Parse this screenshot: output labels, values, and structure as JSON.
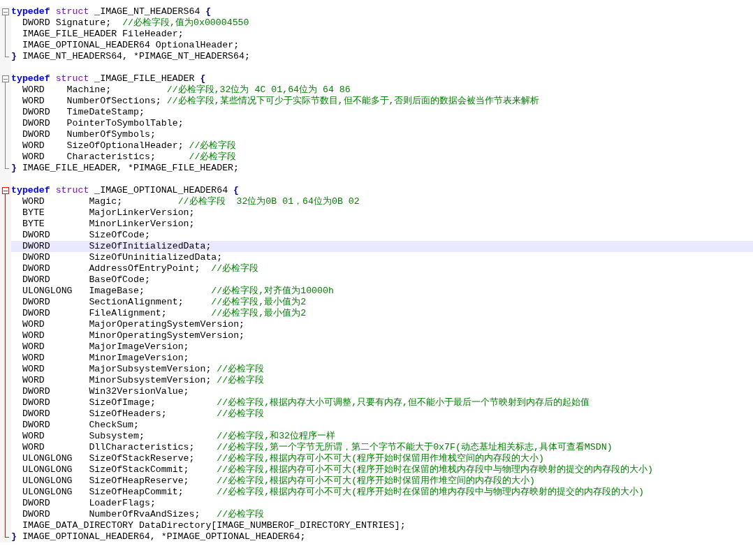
{
  "blocks": [
    {
      "expanded": true,
      "active": false,
      "header": [
        {
          "kind": "keyword",
          "text": "typedef"
        },
        {
          "kind": "storage",
          "text": "struct"
        },
        {
          "kind": "ident",
          "text": "_IMAGE_NT_HEADERS64"
        },
        {
          "kind": "punct",
          "text": "{"
        }
      ],
      "lines": [
        {
          "highlighted": false,
          "code": "DWORD Signature;  ",
          "comment": "//必检字段,值为0x00004550"
        },
        {
          "highlighted": false,
          "code": "IMAGE_FILE_HEADER FileHeader;"
        },
        {
          "highlighted": false,
          "code": "IMAGE_OPTIONAL_HEADER64 OptionalHeader;"
        }
      ],
      "footer": [
        {
          "kind": "punct",
          "text": "}"
        },
        {
          "kind": "ident",
          "text": "IMAGE_NT_HEADERS64, *PIMAGE_NT_HEADERS64;"
        }
      ]
    },
    {
      "expanded": true,
      "active": false,
      "header": [
        {
          "kind": "keyword",
          "text": "typedef"
        },
        {
          "kind": "storage",
          "text": "struct"
        },
        {
          "kind": "ident",
          "text": "_IMAGE_FILE_HEADER"
        },
        {
          "kind": "punct",
          "text": "{"
        }
      ],
      "lines": [
        {
          "highlighted": false,
          "code": "WORD    Machine;          ",
          "comment": "//必检字段,32位为 4C 01,64位为 64 86"
        },
        {
          "highlighted": false,
          "code": "WORD    NumberOfSections; ",
          "comment": "//必检字段,某些情况下可少于实际节数目,但不能多于,否则后面的数据会被当作节表来解析"
        },
        {
          "highlighted": false,
          "code": "DWORD   TimeDateStamp;"
        },
        {
          "highlighted": false,
          "code": "DWORD   PointerToSymbolTable;"
        },
        {
          "highlighted": false,
          "code": "DWORD   NumberOfSymbols;"
        },
        {
          "highlighted": false,
          "code": "WORD    SizeOfOptionalHeader; ",
          "comment": "//必检字段"
        },
        {
          "highlighted": false,
          "code": "WORD    Characteristics;      ",
          "comment": "//必检字段"
        }
      ],
      "footer": [
        {
          "kind": "punct",
          "text": "}"
        },
        {
          "kind": "ident",
          "text": "IMAGE_FILE_HEADER, *PIMAGE_FILE_HEADER;"
        }
      ]
    },
    {
      "expanded": true,
      "active": true,
      "header": [
        {
          "kind": "keyword",
          "text": "typedef"
        },
        {
          "kind": "storage",
          "text": "struct"
        },
        {
          "kind": "ident",
          "text": "_IMAGE_OPTIONAL_HEADER64"
        },
        {
          "kind": "punct",
          "text": "{"
        }
      ],
      "lines": [
        {
          "highlighted": false,
          "code": "WORD        Magic;          ",
          "comment": "//必检字段  32位为0B 01，64位为0B 02"
        },
        {
          "highlighted": false,
          "code": "BYTE        MajorLinkerVersion;"
        },
        {
          "highlighted": false,
          "code": "BYTE        MinorLinkerVersion;"
        },
        {
          "highlighted": false,
          "code": "DWORD       SizeOfCode;"
        },
        {
          "highlighted": true,
          "code": "DWORD       SizeOfInitializedData;"
        },
        {
          "highlighted": false,
          "code": "DWORD       SizeOfUninitializedData;"
        },
        {
          "highlighted": false,
          "code": "DWORD       AddressOfEntryPoint;  ",
          "comment": "//必检字段"
        },
        {
          "highlighted": false,
          "code": "DWORD       BaseOfCode;"
        },
        {
          "highlighted": false,
          "code": "ULONGLONG   ImageBase;            ",
          "comment": "//必检字段,对齐值为10000h"
        },
        {
          "highlighted": false,
          "code": "DWORD       SectionAlignment;     ",
          "comment": "//必检字段,最小值为2"
        },
        {
          "highlighted": false,
          "code": "DWORD       FileAlignment;        ",
          "comment": "//必检字段,最小值为2"
        },
        {
          "highlighted": false,
          "code": "WORD        MajorOperatingSystemVersion;"
        },
        {
          "highlighted": false,
          "code": "WORD        MinorOperatingSystemVersion;"
        },
        {
          "highlighted": false,
          "code": "WORD        MajorImageVersion;"
        },
        {
          "highlighted": false,
          "code": "WORD        MinorImageVersion;"
        },
        {
          "highlighted": false,
          "code": "WORD        MajorSubsystemVersion; ",
          "comment": "//必检字段"
        },
        {
          "highlighted": false,
          "code": "WORD        MinorSubsystemVersion; ",
          "comment": "//必检字段"
        },
        {
          "highlighted": false,
          "code": "DWORD       Win32VersionValue;"
        },
        {
          "highlighted": false,
          "code": "DWORD       SizeOfImage;           ",
          "comment": "//必检字段,根据内存大小可调整,只要有内存,但不能小于最后一个节映射到内存后的起始值"
        },
        {
          "highlighted": false,
          "code": "DWORD       SizeOfHeaders;         ",
          "comment": "//必检字段"
        },
        {
          "highlighted": false,
          "code": "DWORD       CheckSum;"
        },
        {
          "highlighted": false,
          "code": "WORD        Subsystem;             ",
          "comment": "//必检字段,和32位程序一样"
        },
        {
          "highlighted": false,
          "code": "WORD        DllCharacteristics;    ",
          "comment": "//必检字段,第一个字节无所谓，第二个字节不能大于0x7F(动态基址相关标志,具体可查看MSDN)"
        },
        {
          "highlighted": false,
          "code": "ULONGLONG   SizeOfStackReserve;    ",
          "comment": "//必检字段,根据内存可小不可大(程序开始时保留用作堆栈空间的内存段的大小)"
        },
        {
          "highlighted": false,
          "code": "ULONGLONG   SizeOfStackCommit;     ",
          "comment": "//必检字段,根据内存可小不可大(程序开始时在保留的堆栈内存段中与物理内存映射的提交的内存段的大小)"
        },
        {
          "highlighted": false,
          "code": "ULONGLONG   SizeOfHeapReserve;     ",
          "comment": "//必检字段,根据内存可小不可大(程序开始时保留用作堆空间的内存段的大小)"
        },
        {
          "highlighted": false,
          "code": "ULONGLONG   SizeOfHeapCommit;      ",
          "comment": "//必检字段,根据内存可小不可大(程序开始时在保留的堆内存段中与物理内存映射的提交的内存段的大小)"
        },
        {
          "highlighted": false,
          "code": "DWORD       LoaderFlags;"
        },
        {
          "highlighted": false,
          "code": "DWORD       NumberOfRvaAndSizes;   ",
          "comment": "//必检字段"
        },
        {
          "highlighted": false,
          "code": "IMAGE_DATA_DIRECTORY DataDirectory[IMAGE_NUMBEROF_DIRECTORY_ENTRIES];"
        }
      ],
      "footer": [
        {
          "kind": "punct",
          "text": "}"
        },
        {
          "kind": "ident",
          "text": "IMAGE_OPTIONAL_HEADER64, *PIMAGE_OPTIONAL_HEADER64;"
        }
      ]
    }
  ]
}
